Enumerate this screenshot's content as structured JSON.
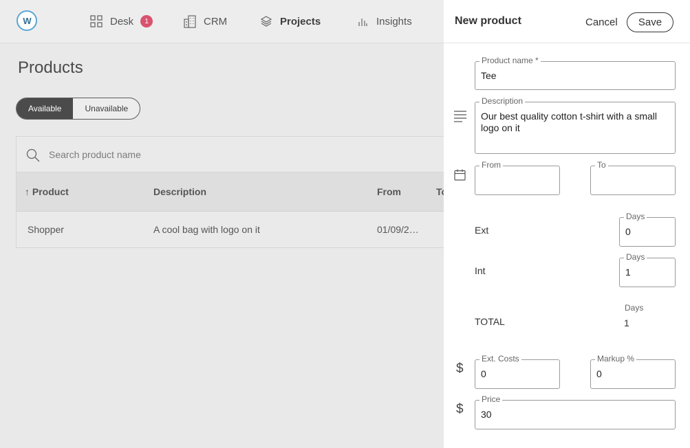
{
  "nav": {
    "items": [
      {
        "label": "Desk",
        "icon": "grid-icon",
        "badge": "1"
      },
      {
        "label": "CRM",
        "icon": "building-icon"
      },
      {
        "label": "Projects",
        "icon": "layers-icon"
      },
      {
        "label": "Insights",
        "icon": "bar-chart-icon"
      }
    ],
    "active": "Projects"
  },
  "page": {
    "title": "Products",
    "filter": {
      "available": "Available",
      "unavailable": "Unavailable"
    },
    "search_placeholder": "Search product name",
    "columns": [
      "Product",
      "Description",
      "From",
      "To"
    ],
    "rows": [
      {
        "product": "Shopper",
        "description": "A cool bag with logo on it",
        "from": "01/09/2…",
        "to": ""
      }
    ]
  },
  "panel": {
    "title": "New product",
    "cancel": "Cancel",
    "save": "Save",
    "product_name_label": "Product name *",
    "product_name_value": "Tee",
    "description_label": "Description",
    "description_value": "Our best quality cotton t-shirt with a small logo on it",
    "from_label": "From",
    "from_value": "",
    "to_label": "To",
    "to_value": "",
    "ext_label": "Ext",
    "ext_days_label": "Days",
    "ext_days_value": "0",
    "int_label": "Int",
    "int_days_label": "Days",
    "int_days_value": "1",
    "total_label": "TOTAL",
    "total_days_label": "Days",
    "total_days_value": "1",
    "ext_costs_label": "Ext. Costs",
    "ext_costs_value": "0",
    "markup_label": "Markup %",
    "markup_value": "0",
    "price_label": "Price",
    "price_value": "30",
    "currency_symbol": "$"
  },
  "colors": {
    "badge": "#d9536f",
    "logo_ring": "#5aa6d6",
    "segment_active": "#4b4b4b"
  }
}
